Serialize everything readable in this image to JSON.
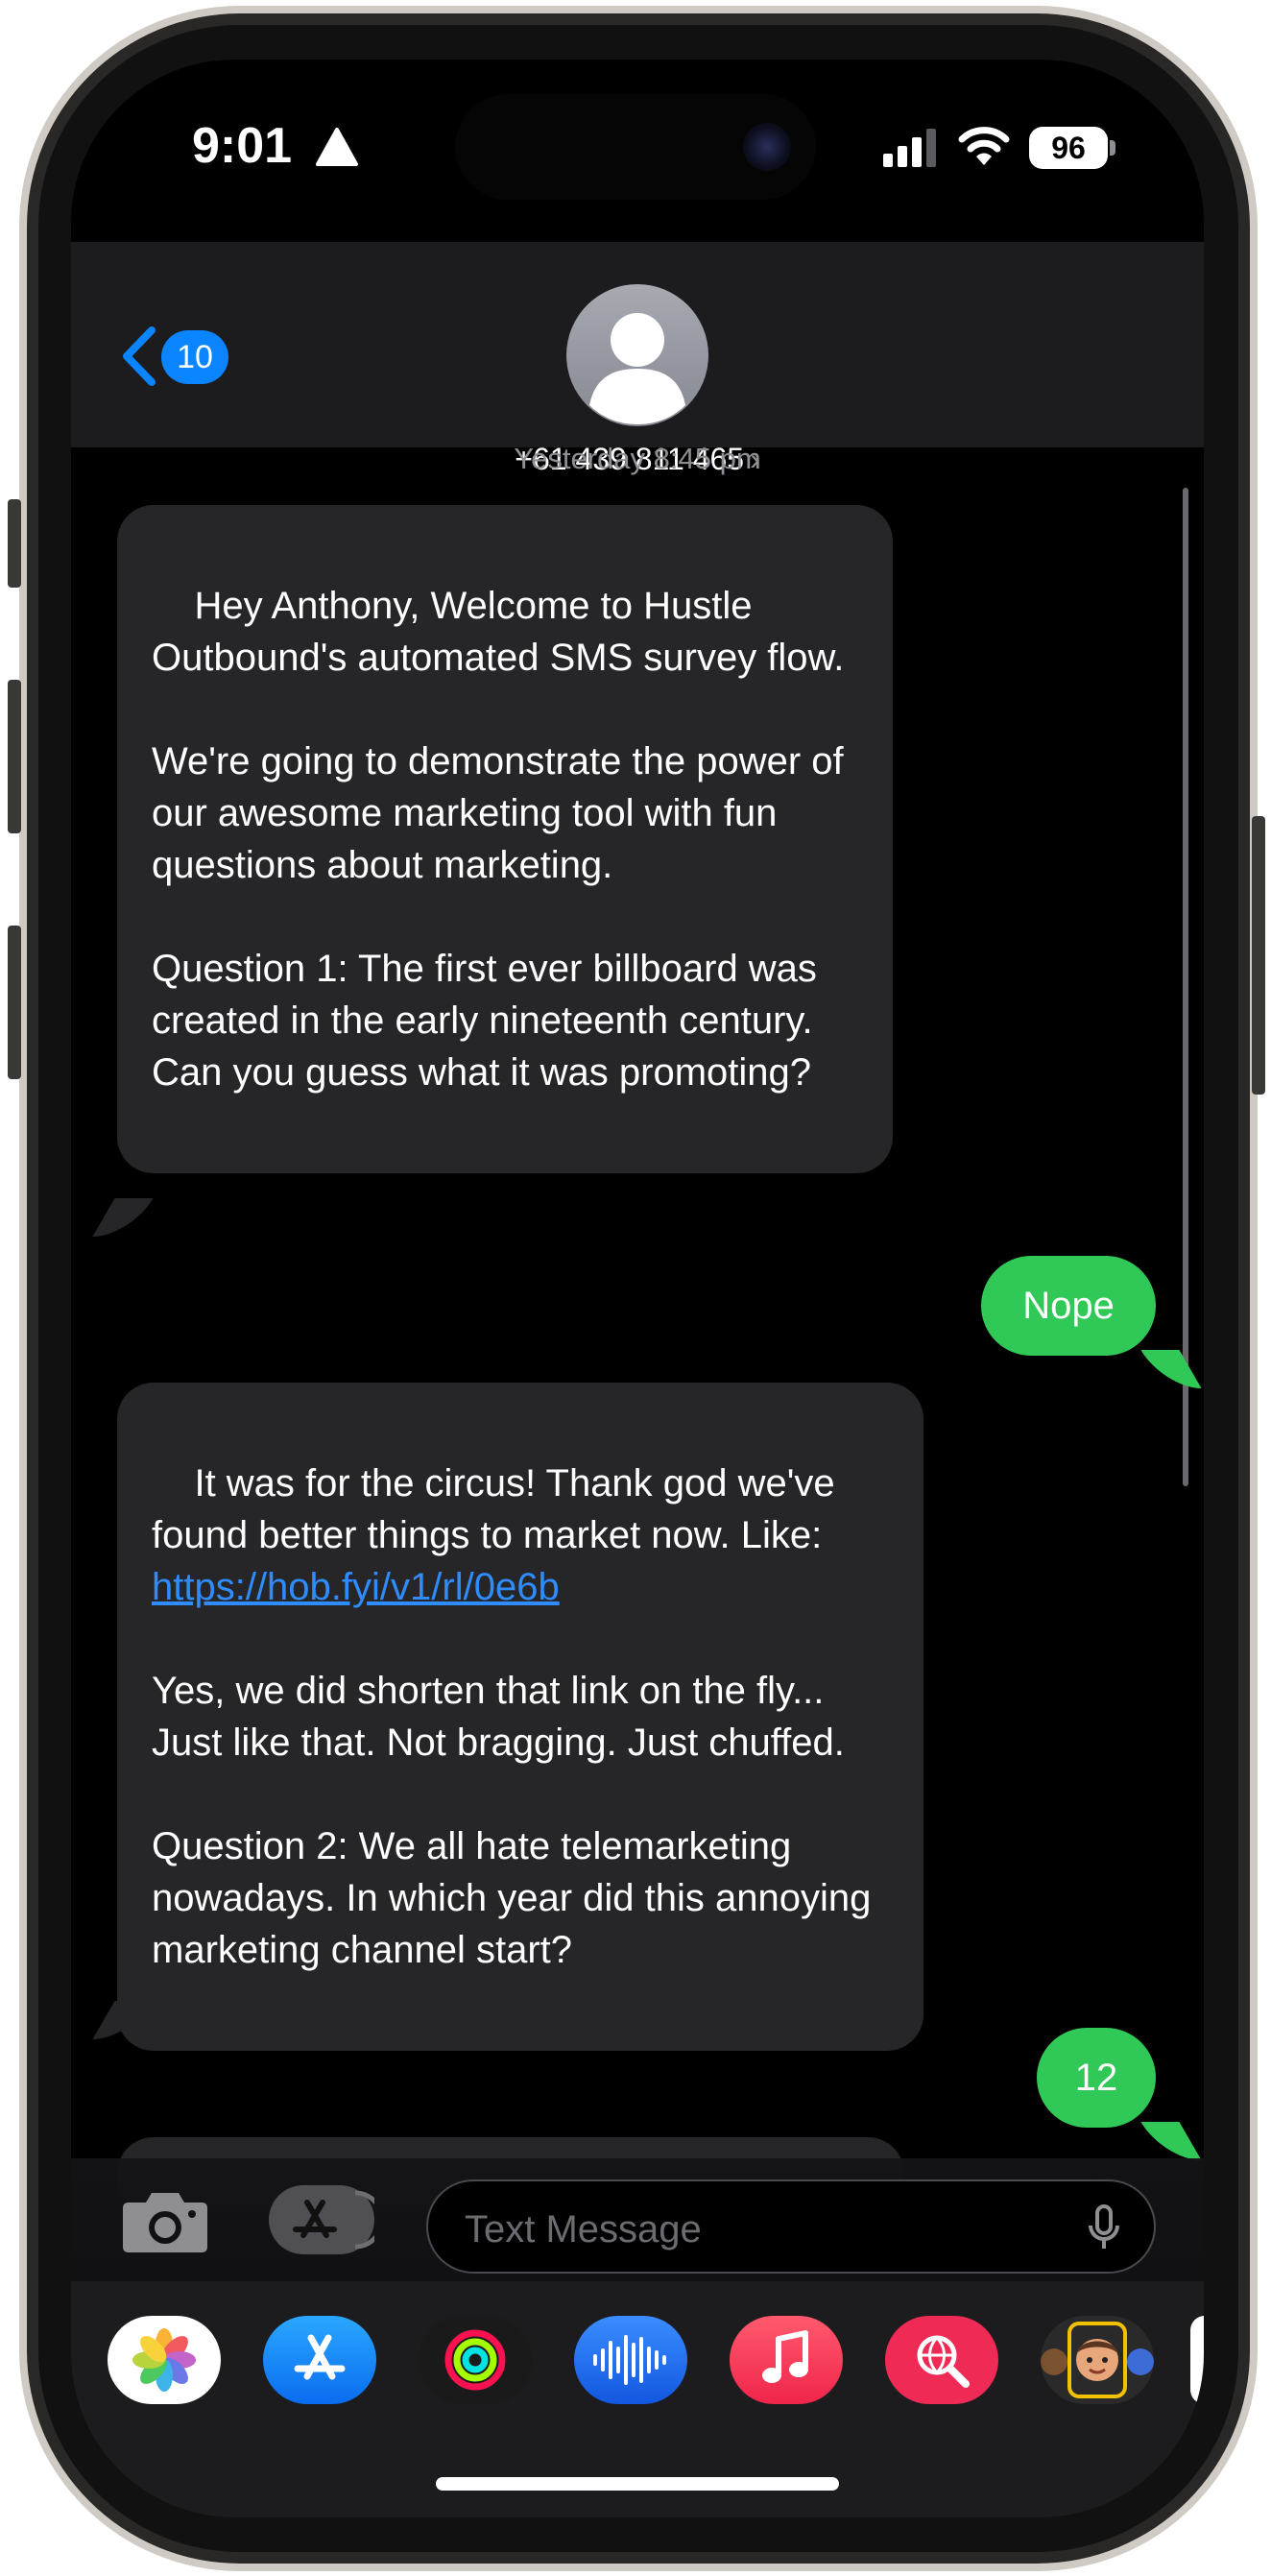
{
  "status_bar": {
    "time": "9:01",
    "battery": "96"
  },
  "header": {
    "back_badge": "10",
    "contact_name": "+61 439 811 465",
    "chevron": "›"
  },
  "conversation": {
    "timestamp": "Yesterday 8:45 pm",
    "messages": [
      {
        "direction": "incoming",
        "text": "Hey Anthony, Welcome to Hustle Outbound's automated SMS survey flow.\n\nWe're going to demonstrate the power of our awesome marketing tool with fun questions about marketing.\n\nQuestion 1: The first ever billboard was created in the early nineteenth century. Can you guess what it was promoting?"
      },
      {
        "direction": "outgoing",
        "text": "Nope"
      },
      {
        "direction": "incoming",
        "text_before_link": "It was for the circus! Thank god we've found better things to market now. Like: ",
        "link": "https://hob.fyi/v1/rl/0e6b",
        "text_after_link": "\n\nYes, we did shorten that link on the fly... Just like that. Not bragging. Just chuffed.\n\nQuestion 2: We all hate telemarketing nowadays. In which year did this annoying marketing channel start?"
      },
      {
        "direction": "outgoing",
        "text": "12"
      }
    ]
  },
  "composer": {
    "placeholder": "Text Message"
  },
  "app_drawer": {
    "apps": [
      "photos-app",
      "app-store-app",
      "fitness-app",
      "voice-memos-app",
      "music-app",
      "image-search-app",
      "memoji-app"
    ]
  },
  "colors": {
    "incoming_bubble": "#262628",
    "outgoing_bubble": "#30c856",
    "link": "#2f8cff",
    "accent": "#0a84ff"
  }
}
